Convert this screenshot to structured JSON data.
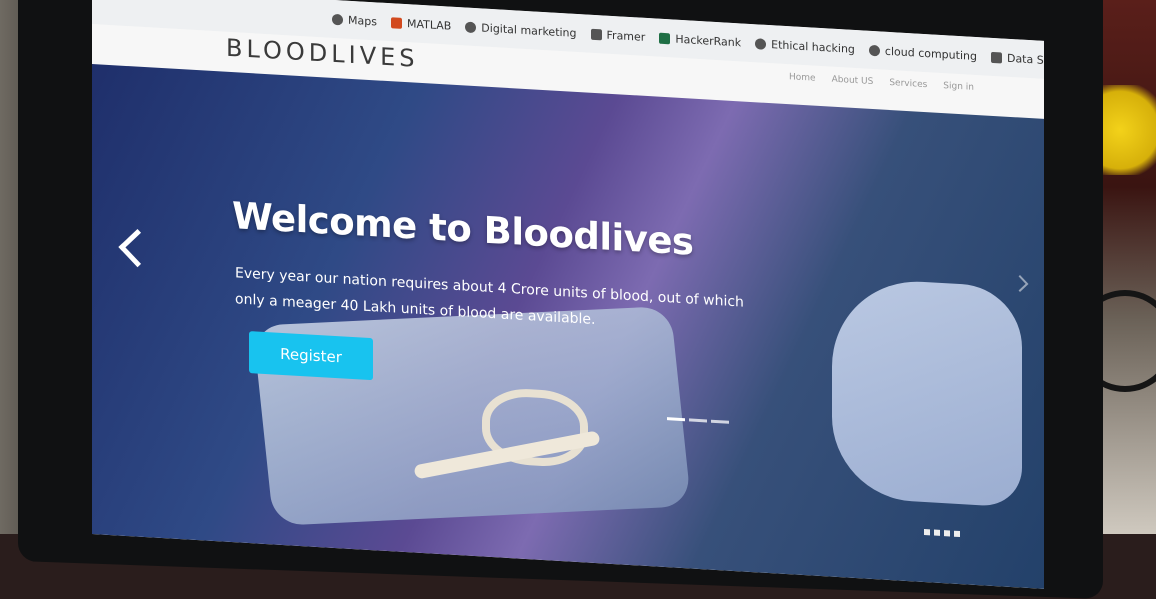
{
  "bookmarks": [
    {
      "label": "Maps",
      "icon": "maps-icon"
    },
    {
      "label": "MATLAB",
      "icon": "matlab-icon"
    },
    {
      "label": "Digital marketing",
      "icon": "globe-icon"
    },
    {
      "label": "Framer",
      "icon": "framer-icon"
    },
    {
      "label": "HackerRank",
      "icon": "hackerrank-icon"
    },
    {
      "label": "Ethical hacking",
      "icon": "globe-icon"
    },
    {
      "label": "cloud computing",
      "icon": "globe-icon"
    },
    {
      "label": "Data Science",
      "icon": "dollar-icon"
    }
  ],
  "site": {
    "logo": "BLOODLIVES",
    "nav": [
      "Home",
      "About US",
      "Services",
      "Sign in"
    ]
  },
  "hero": {
    "title": "Welcome to Bloodlives",
    "description": "Every year our nation requires about 4 Crore units of blood, out of which only a meager 40 Lakh units of blood are available.",
    "button": "Register",
    "active_slide": 1,
    "slide_count": 3
  },
  "colors": {
    "accent": "#18c3ef",
    "hero_overlay": "#2f4a86"
  }
}
